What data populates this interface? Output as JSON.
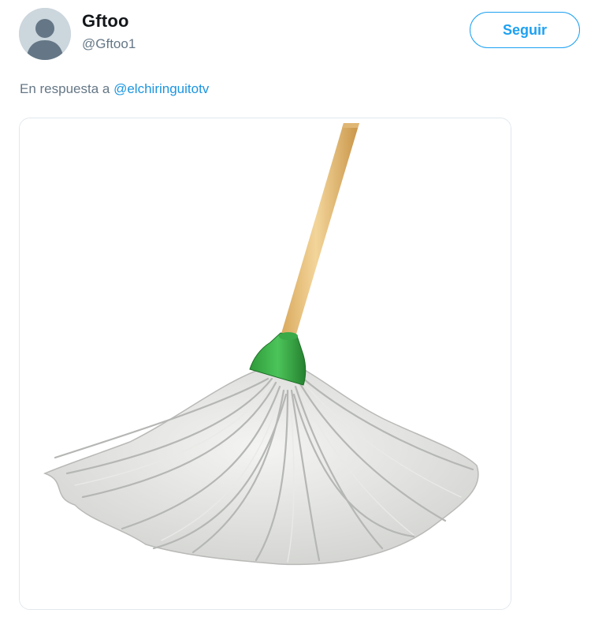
{
  "tweet": {
    "author": {
      "display_name": "Gftoo",
      "handle": "@Gftoo1",
      "avatar_icon": "default-profile-icon"
    },
    "follow_label": "Seguir",
    "reply_prefix": "En respuesta a",
    "reply_mention": "@elchiringuitotv",
    "media": {
      "description_icon": "mop-image"
    }
  },
  "colors": {
    "accent": "#1da1f2",
    "mention": "#1b95e0",
    "secondary_text": "#657786",
    "avatar_bg": "#ccd6dd",
    "card_border": "#e1e8ed"
  }
}
